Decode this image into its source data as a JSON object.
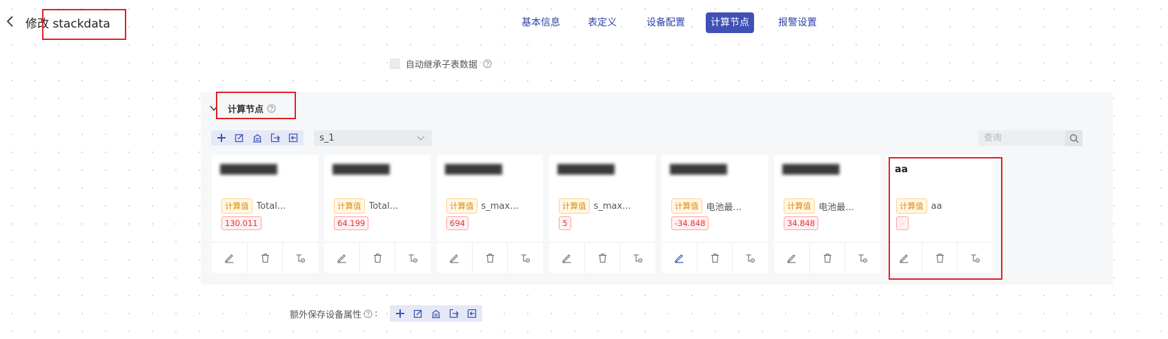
{
  "header": {
    "back_icon": "chevron-left-icon",
    "title": "修改 stackdata"
  },
  "nav": {
    "tabs": [
      {
        "label": "基本信息",
        "active": false
      },
      {
        "label": "表定义",
        "active": false
      },
      {
        "label": "设备配置",
        "active": false
      },
      {
        "label": "计算节点",
        "active": true
      },
      {
        "label": "报警设置",
        "active": false
      }
    ]
  },
  "inherit": {
    "label": "自动继承子表数据",
    "checked": false
  },
  "section": {
    "title": "计算节点",
    "expanded": true
  },
  "toolbar": {
    "icons": [
      "plus-icon",
      "edit-icon",
      "building-icon",
      "export-icon",
      "import-icon"
    ]
  },
  "select": {
    "value": "s_1"
  },
  "search": {
    "placeholder": "查询"
  },
  "cards": [
    {
      "name": "████████",
      "blurred": true,
      "type": "计算值",
      "label": "Total...",
      "value": "130.011"
    },
    {
      "name": "████████",
      "blurred": true,
      "type": "计算值",
      "label": "Total...",
      "value": "64.199"
    },
    {
      "name": "████████",
      "blurred": true,
      "type": "计算值",
      "label": "s_max...",
      "value": "694"
    },
    {
      "name": "████████",
      "blurred": true,
      "type": "计算值",
      "label": "s_max...",
      "value": "5"
    },
    {
      "name": "████████",
      "blurred": true,
      "type": "计算值",
      "label": "电池最...",
      "value": "-34.848"
    },
    {
      "name": "████████",
      "blurred": true,
      "type": "计算值",
      "label": "电池最...",
      "value": "34.848"
    },
    {
      "name": "aa",
      "blurred": false,
      "type": "计算值",
      "label": "aa",
      "value": "-"
    }
  ],
  "card_action_icons": [
    "edit-icon",
    "trash-icon",
    "node-settings-icon"
  ],
  "extra": {
    "label": "额外保存设备属性",
    "colon": ":"
  },
  "colors": {
    "primary": "#3f51b5",
    "highlight": "#e01e25",
    "badge_orange": "#e08a00",
    "badge_red": "#d9363e"
  }
}
